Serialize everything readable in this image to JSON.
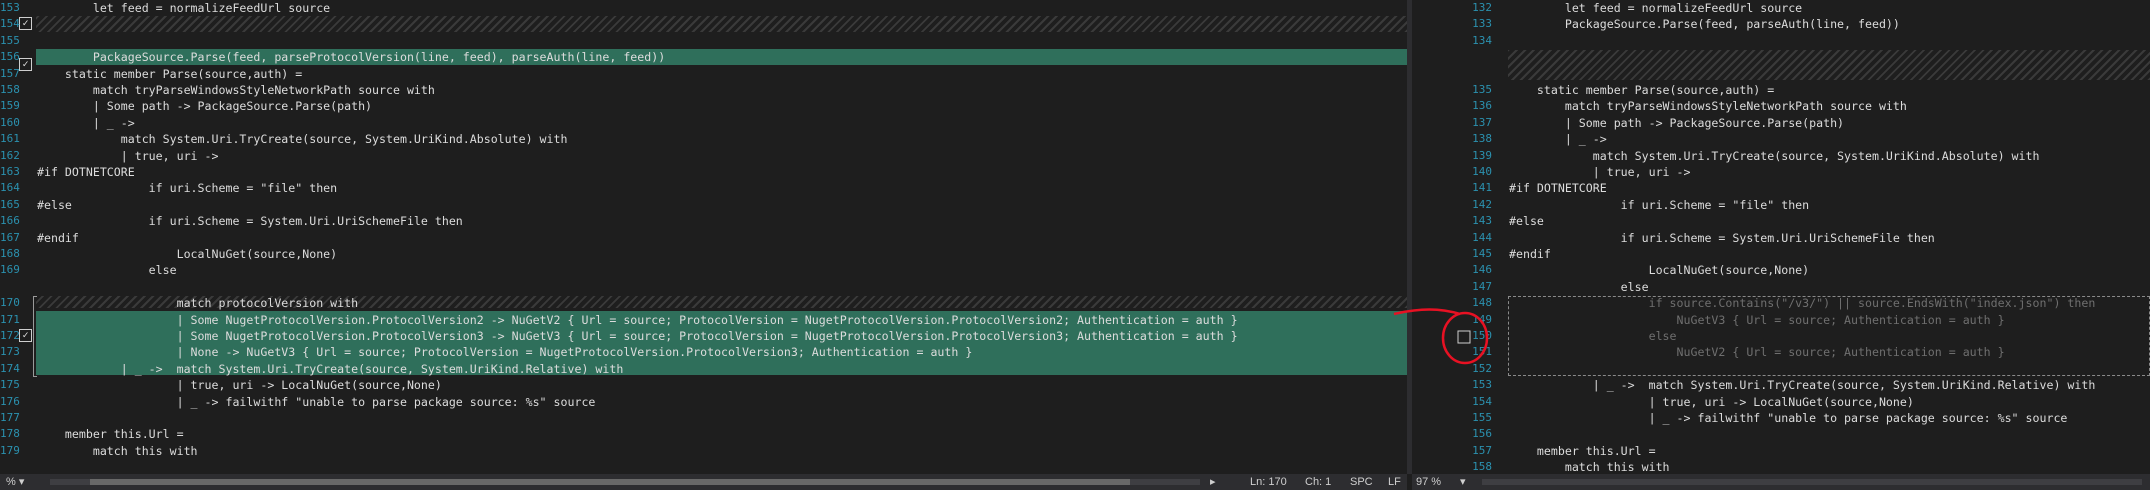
{
  "left": {
    "lines": [
      {
        "n": "153",
        "t": "        let feed = normalizeFeedUrl source"
      },
      {
        "n": "154",
        "t": ""
      },
      {
        "n": "155",
        "t": ""
      },
      {
        "n": "156",
        "t": "        PackageSource.Parse(feed, parseProtocolVersion(line, feed), parseAuth(line, feed))"
      },
      {
        "n": "157",
        "t": "    static member Parse(source,auth) ="
      },
      {
        "n": "158",
        "t": "        match tryParseWindowsStyleNetworkPath source with"
      },
      {
        "n": "159",
        "t": "        | Some path -> PackageSource.Parse(path)"
      },
      {
        "n": "160",
        "t": "        | _ ->"
      },
      {
        "n": "161",
        "t": "            match System.Uri.TryCreate(source, System.UriKind.Absolute) with"
      },
      {
        "n": "162",
        "t": "            | true, uri ->"
      },
      {
        "n": "163",
        "t": "#if DOTNETCORE"
      },
      {
        "n": "164",
        "t": "                if uri.Scheme = \"file\" then"
      },
      {
        "n": "165",
        "t": "#else"
      },
      {
        "n": "166",
        "t": "                if uri.Scheme = System.Uri.UriSchemeFile then"
      },
      {
        "n": "167",
        "t": "#endif"
      },
      {
        "n": "168",
        "t": "                    LocalNuGet(source,None)"
      },
      {
        "n": "169",
        "t": "                else"
      },
      {
        "n": "",
        "t": ""
      },
      {
        "n": "170",
        "t": "                    match protocolVersion with"
      },
      {
        "n": "171",
        "t": "                    | Some NugetProtocolVersion.ProtocolVersion2 -> NuGetV2 { Url = source; ProtocolVersion = NugetProtocolVersion.ProtocolVersion2; Authentication = auth }"
      },
      {
        "n": "172",
        "t": "                    | Some NugetProtocolVersion.ProtocolVersion3 -> NuGetV3 { Url = source; ProtocolVersion = NugetProtocolVersion.ProtocolVersion3; Authentication = auth }"
      },
      {
        "n": "173",
        "t": "                    | None -> NuGetV3 { Url = source; ProtocolVersion = NugetProtocolVersion.ProtocolVersion3; Authentication = auth }"
      },
      {
        "n": "174",
        "t": "            | _ ->  match System.Uri.TryCreate(source, System.UriKind.Relative) with"
      },
      {
        "n": "175",
        "t": "                    | true, uri -> LocalNuGet(source,None)"
      },
      {
        "n": "176",
        "t": "                    | _ -> failwithf \"unable to parse package source: %s\" source"
      },
      {
        "n": "177",
        "t": ""
      },
      {
        "n": "178",
        "t": "    member this.Url ="
      },
      {
        "n": "179",
        "t": "        match this with"
      }
    ]
  },
  "right": {
    "lines": [
      {
        "n": "132",
        "t": "        let feed = normalizeFeedUrl source"
      },
      {
        "n": "133",
        "t": "        PackageSource.Parse(feed, parseAuth(line, feed))"
      },
      {
        "n": "134",
        "t": ""
      },
      {
        "n": "",
        "t": ""
      },
      {
        "n": "",
        "t": ""
      },
      {
        "n": "135",
        "t": "    static member Parse(source,auth) ="
      },
      {
        "n": "136",
        "t": "        match tryParseWindowsStyleNetworkPath source with"
      },
      {
        "n": "137",
        "t": "        | Some path -> PackageSource.Parse(path)"
      },
      {
        "n": "138",
        "t": "        | _ ->"
      },
      {
        "n": "139",
        "t": "            match System.Uri.TryCreate(source, System.UriKind.Absolute) with"
      },
      {
        "n": "140",
        "t": "            | true, uri ->"
      },
      {
        "n": "141",
        "t": "#if DOTNETCORE"
      },
      {
        "n": "142",
        "t": "                if uri.Scheme = \"file\" then"
      },
      {
        "n": "143",
        "t": "#else"
      },
      {
        "n": "144",
        "t": "                if uri.Scheme = System.Uri.UriSchemeFile then"
      },
      {
        "n": "145",
        "t": "#endif"
      },
      {
        "n": "146",
        "t": "                    LocalNuGet(source,None)"
      },
      {
        "n": "147",
        "t": "                else"
      },
      {
        "n": "148",
        "t": "                    if source.Contains(\"/v3/\") || source.EndsWith(\"index.json\") then"
      },
      {
        "n": "149",
        "t": "                        NuGetV3 { Url = source; Authentication = auth }"
      },
      {
        "n": "150",
        "t": "                    else"
      },
      {
        "n": "151",
        "t": "                        NuGetV2 { Url = source; Authentication = auth }"
      },
      {
        "n": "152",
        "t": ""
      },
      {
        "n": "153",
        "t": "            | _ ->  match System.Uri.TryCreate(source, System.UriKind.Relative) with"
      },
      {
        "n": "154",
        "t": "                    | true, uri -> LocalNuGet(source,None)"
      },
      {
        "n": "155",
        "t": "                    | _ -> failwithf \"unable to parse package source: %s\" source"
      },
      {
        "n": "156",
        "t": ""
      },
      {
        "n": "157",
        "t": "    member this.Url ="
      },
      {
        "n": "158",
        "t": "        match this with"
      }
    ]
  },
  "status": {
    "left_zoom": "% ▾",
    "ln": "Ln: 170",
    "ch": "Ch: 1",
    "spc": "SPC",
    "lf": "LF",
    "right_zoom": "97 %",
    "check_glyph": "✓"
  },
  "colors": {
    "background": "#1e1e1e",
    "added_block": "#2f6f5b",
    "line_number": "#2b91af",
    "connector": "#e81123"
  }
}
